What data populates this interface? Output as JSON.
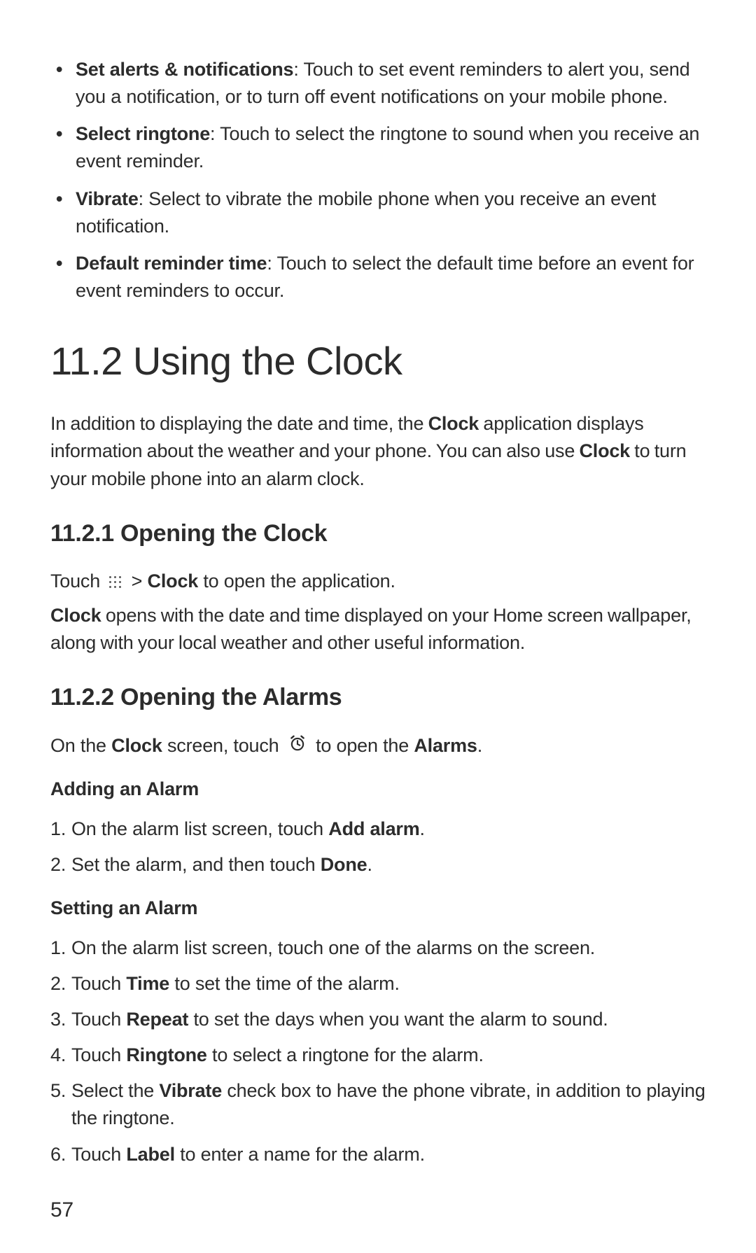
{
  "topList": [
    {
      "label": "Set alerts & notifications",
      "desc": ": Touch to set event reminders to alert you, send you a notification, or to turn off event notifications on your mobile phone."
    },
    {
      "label": "Select ringtone",
      "desc": ": Touch to select the ringtone to sound when you receive an event reminder."
    },
    {
      "label": "Vibrate",
      "desc": ": Select to vibrate the mobile phone when you receive an event notification."
    },
    {
      "label": "Default reminder time",
      "desc": ": Touch to select the default time before an event for event reminders to occur."
    }
  ],
  "heading": "11.2  Using the Clock",
  "intro": {
    "p1a": "In addition to displaying the date and time, the ",
    "p1b": "Clock",
    "p1c": " application displays information about the weather and your phone. You can also use ",
    "p1d": "Clock",
    "p1e": " to turn your mobile phone into an alarm clock."
  },
  "sub1": "11.2.1  Opening the Clock",
  "open1": {
    "a": "Touch ",
    "b": " > ",
    "c": "Clock",
    "d": " to open the application."
  },
  "open2": {
    "a": "Clock",
    "b": " opens with the date and time displayed on your Home screen wallpaper, along with your local weather and other useful information."
  },
  "sub2": "11.2.2  Opening the Alarms",
  "alarms": {
    "a": "On the ",
    "b": "Clock",
    "c": " screen, touch ",
    "d": " to open the ",
    "e": "Alarms",
    "f": "."
  },
  "adding": {
    "title": "Adding an Alarm",
    "steps": [
      {
        "a": "On the alarm list screen, touch ",
        "b": "Add alarm",
        "c": "."
      },
      {
        "a": "Set the alarm, and then touch ",
        "b": "Done",
        "c": "."
      }
    ]
  },
  "setting": {
    "title": "Setting an Alarm",
    "steps": [
      {
        "a": "On the alarm list screen, touch one of the alarms on the screen.",
        "b": "",
        "c": ""
      },
      {
        "a": "Touch ",
        "b": "Time",
        "c": " to set the time of the alarm."
      },
      {
        "a": "Touch ",
        "b": "Repeat",
        "c": " to set the days when you want the alarm to sound."
      },
      {
        "a": "Touch ",
        "b": "Ringtone",
        "c": " to select a ringtone for the alarm."
      },
      {
        "a": "Select the ",
        "b": "Vibrate",
        "c": " check box to have the phone vibrate, in addition to playing the ringtone."
      },
      {
        "a": "Touch ",
        "b": "Label",
        "c": " to enter a name for the alarm."
      }
    ]
  },
  "pageNumber": "57"
}
